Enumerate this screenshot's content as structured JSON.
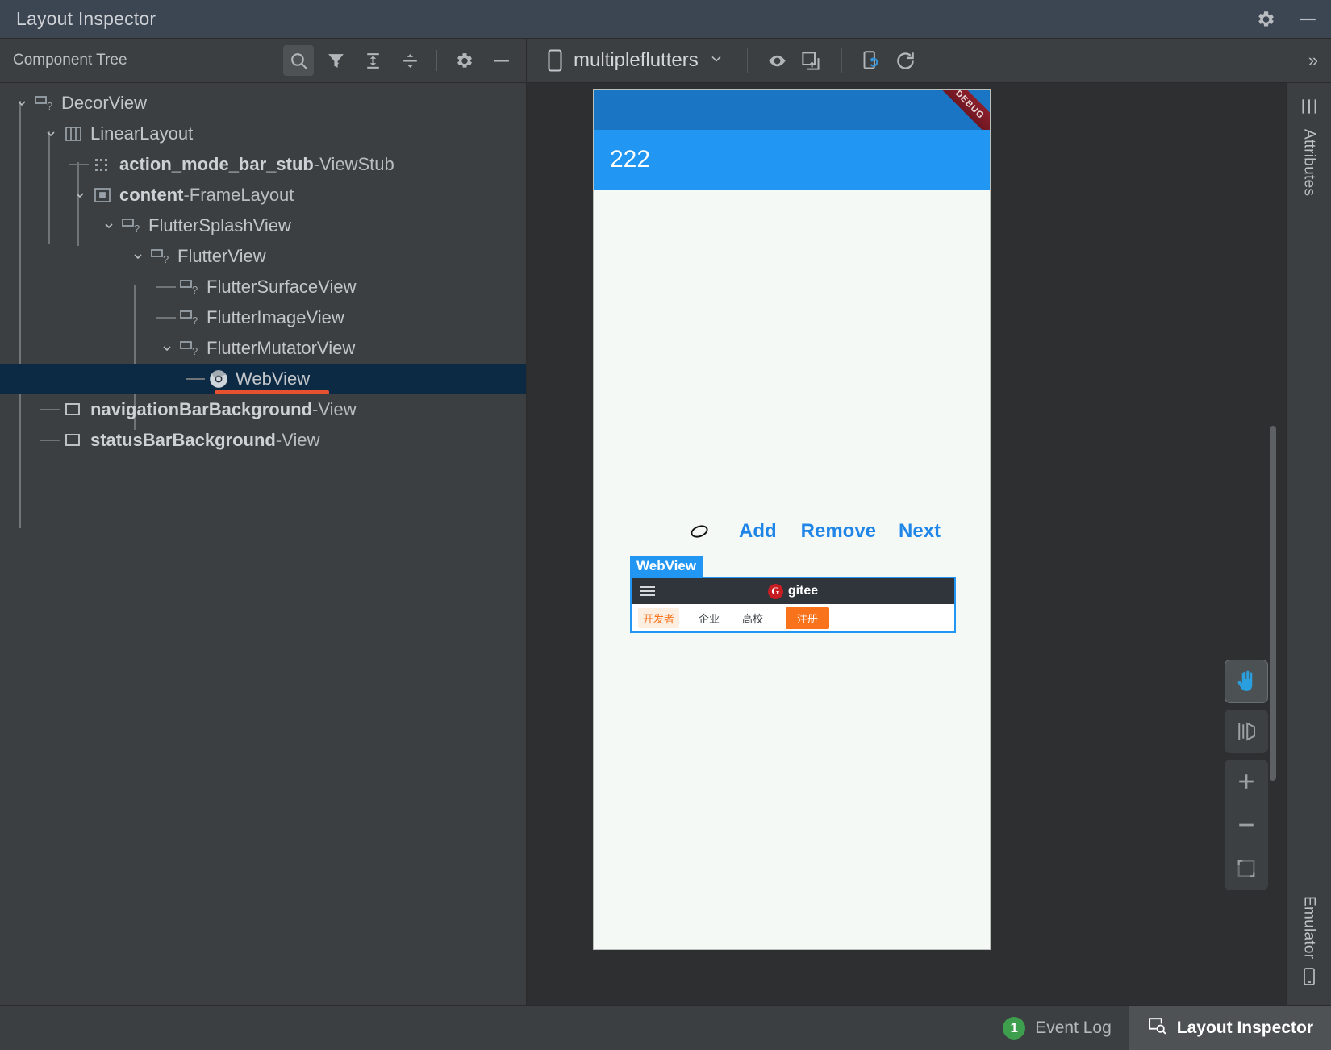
{
  "window": {
    "title": "Layout Inspector",
    "settings_icon": "gear-icon",
    "minimize_icon": "minimize-icon"
  },
  "component_tree_panel": {
    "header_label": "Component Tree",
    "toolbar": [
      {
        "name": "search-icon",
        "label": "Search",
        "active": true
      },
      {
        "name": "filter-icon",
        "label": "Filter"
      },
      {
        "name": "expand-all-icon",
        "label": "Expand All"
      },
      {
        "name": "collapse-all-icon",
        "label": "Collapse All"
      },
      {
        "name": "gear-icon",
        "label": "Settings"
      },
      {
        "name": "minimize-icon",
        "label": "Minimize"
      }
    ],
    "nodes": [
      {
        "depth": 0,
        "twisty": "down",
        "icon": "view-unknown-icon",
        "id": "",
        "type": "DecorView",
        "bold_id": false,
        "selected": false
      },
      {
        "depth": 1,
        "twisty": "down",
        "icon": "linear-layout-icon",
        "id": "",
        "type": "LinearLayout",
        "bold_id": false,
        "selected": false
      },
      {
        "depth": 2,
        "twisty": "none",
        "icon": "view-stub-icon",
        "id": "action_mode_bar_stub",
        "type": "ViewStub",
        "bold_id": true,
        "selected": false
      },
      {
        "depth": 2,
        "twisty": "down",
        "icon": "frame-layout-icon",
        "id": "content",
        "type": "FrameLayout",
        "bold_id": true,
        "selected": false
      },
      {
        "depth": 3,
        "twisty": "down",
        "icon": "view-unknown-icon",
        "id": "",
        "type": "FlutterSplashView",
        "bold_id": false,
        "selected": false
      },
      {
        "depth": 4,
        "twisty": "down",
        "icon": "view-unknown-icon",
        "id": "",
        "type": "FlutterView",
        "bold_id": false,
        "selected": false
      },
      {
        "depth": 5,
        "twisty": "none",
        "icon": "view-unknown-icon",
        "id": "",
        "type": "FlutterSurfaceView",
        "bold_id": false,
        "selected": false
      },
      {
        "depth": 5,
        "twisty": "none",
        "icon": "view-unknown-icon",
        "id": "",
        "type": "FlutterImageView",
        "bold_id": false,
        "selected": false
      },
      {
        "depth": 5,
        "twisty": "down",
        "icon": "view-unknown-icon",
        "id": "",
        "type": "FlutterMutatorView",
        "bold_id": false,
        "selected": false
      },
      {
        "depth": 6,
        "twisty": "none",
        "icon": "chrome-webview-icon",
        "id": "",
        "type": "WebView",
        "bold_id": false,
        "selected": true
      },
      {
        "depth": 1,
        "twisty": "none",
        "icon": "view-icon",
        "id": "navigationBarBackground",
        "type": "View",
        "bold_id": true,
        "selected": false
      },
      {
        "depth": 1,
        "twisty": "none",
        "icon": "view-icon",
        "id": "statusBarBackground",
        "type": "View",
        "bold_id": true,
        "selected": false
      }
    ]
  },
  "preview_toolbar": {
    "device_icon": "phone-icon",
    "device_name": "multipleflutters",
    "device_dropdown_icon": "chevron-down-icon",
    "buttons": [
      {
        "name": "view-options-icon",
        "label": "View Options"
      },
      {
        "name": "load-overlay-icon",
        "label": "Load Overlay"
      },
      {
        "name": "live-updates-icon",
        "label": "Live Updates"
      },
      {
        "name": "refresh-icon",
        "label": "Refresh"
      }
    ],
    "overflow_icon": "chevrons-right-icon"
  },
  "device_preview": {
    "appbar_title": "222",
    "debug_ribbon": "DEBUG",
    "colors": {
      "status_bar": "#1a76c4",
      "app_bar": "#2196f3",
      "screen_bg": "#f4f9f5",
      "highlight": "#2196f3",
      "selection_underline": "#e8512f"
    },
    "flutter_controls": {
      "spinner_icon": "oval-icon",
      "buttons": [
        "Add",
        "Remove",
        "Next"
      ]
    },
    "webview_overlay": {
      "tag_label": "WebView",
      "gitee": {
        "menu_icon": "hamburger-icon",
        "logo_letter": "G",
        "brand": "gitee",
        "nav_items": [
          {
            "label": "开发者",
            "highlighted": true
          },
          {
            "label": "企业",
            "highlighted": false
          },
          {
            "label": "高校",
            "highlighted": false
          }
        ],
        "register_button": "注册"
      }
    }
  },
  "float_controls": [
    {
      "name": "pan-tool-icon",
      "label": "Pan",
      "selected": true
    },
    {
      "name": "layer-mode-icon",
      "label": "3D Mode",
      "selected": false
    },
    {
      "name": "zoom-in-icon",
      "label": "Zoom In",
      "selected": false
    },
    {
      "name": "zoom-out-icon",
      "label": "Zoom Out",
      "selected": false
    },
    {
      "name": "zoom-to-fit-icon",
      "label": "Zoom to Fit",
      "selected": false
    }
  ],
  "right_strip": {
    "attributes_label": "Attributes",
    "attributes_icon": "attributes-icon",
    "emulator_label": "Emulator",
    "emulator_icon": "emulator-icon"
  },
  "status_bar": {
    "tabs": [
      {
        "label": "Event Log",
        "badge": "1",
        "icon": "",
        "active": false
      },
      {
        "label": "Layout Inspector",
        "badge": "",
        "icon": "layout-inspector-icon",
        "active": true
      }
    ]
  }
}
